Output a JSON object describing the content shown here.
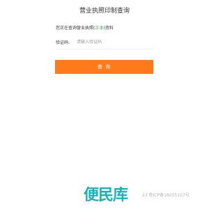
{
  "header": {
    "title": "营业执照印制查询"
  },
  "notice": {
    "prefix": "您正在查询营业执照(",
    "highlight": "正本",
    "suffix": ")资料"
  },
  "form": {
    "captcha_label": "验证码:",
    "captcha_placeholder": "请输入验证码",
    "captcha_value": ""
  },
  "actions": {
    "query_label": "查 询"
  },
  "footer": {
    "logo_text": "便民库",
    "icp_text": "23 粤ICP备18055107号"
  },
  "colors": {
    "accent": "#ff7a1a",
    "highlight": "#4caf50",
    "logo": "#17b3b8"
  }
}
